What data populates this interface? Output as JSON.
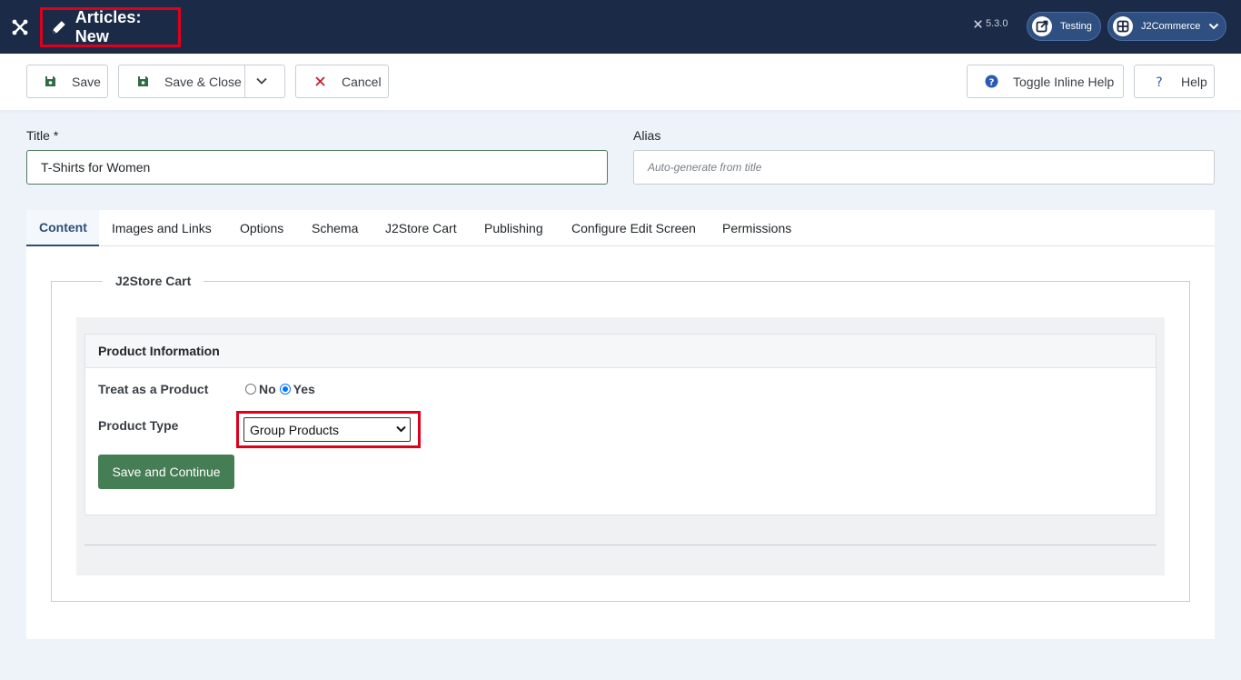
{
  "header": {
    "title": "Articles: New",
    "version": "5.3.0",
    "site_label": "Testing",
    "user_label": "J2Commerce",
    "icons": [
      "joomla-icon",
      "pencil-icon",
      "external-link-icon",
      "grid-icon",
      "chevron-down-icon"
    ]
  },
  "toolbar": {
    "save_label": "Save",
    "save_close_label": "Save & Close",
    "cancel_label": "Cancel",
    "toggle_help_label": "Toggle Inline Help",
    "help_label": "Help"
  },
  "form": {
    "title_label": "Title *",
    "title_value": "T-Shirts for Women",
    "alias_label": "Alias",
    "alias_placeholder": "Auto-generate from title"
  },
  "tabs": [
    {
      "label": "Content",
      "active": true
    },
    {
      "label": "Images and Links"
    },
    {
      "label": "Options"
    },
    {
      "label": "Schema"
    },
    {
      "label": "J2Store Cart"
    },
    {
      "label": "Publishing"
    },
    {
      "label": "Configure Edit Screen"
    },
    {
      "label": "Permissions"
    }
  ],
  "j2store": {
    "legend": "J2Store Cart",
    "card_title": "Product Information",
    "treat_label": "Treat as a Product",
    "no_label": "No",
    "yes_label": "Yes",
    "type_label": "Product Type",
    "type_value": "Group Products",
    "continue_label": "Save and Continue"
  },
  "colors": {
    "header_bg": "#1a2a47",
    "accent_green": "#457d54",
    "highlight_red": "#e0001b",
    "tab_active": "#2a4f7a"
  }
}
